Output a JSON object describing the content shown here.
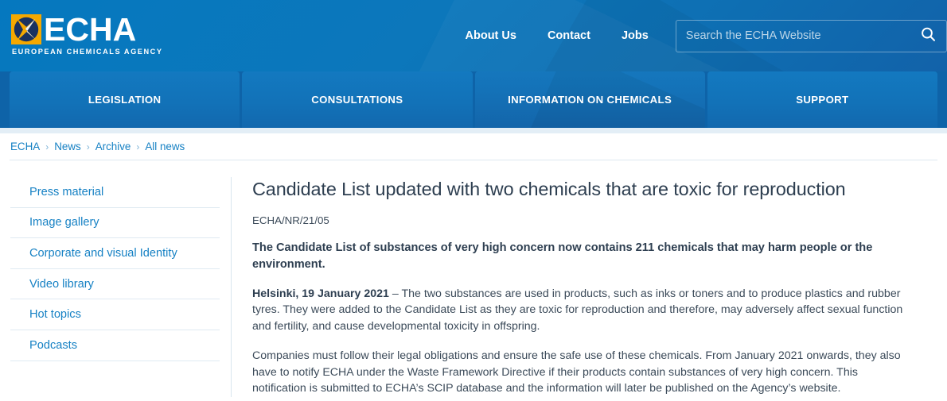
{
  "header": {
    "logo": {
      "mark_icon": "echa-star-logo-icon",
      "wordmark": "ECHA",
      "tagline": "EUROPEAN CHEMICALS AGENCY"
    },
    "top_links": [
      {
        "label": "About Us"
      },
      {
        "label": "Contact"
      },
      {
        "label": "Jobs"
      }
    ],
    "search": {
      "placeholder": "Search the ECHA Website",
      "value": "",
      "submit_icon": "search-icon"
    },
    "colors": {
      "header_bg": "#0c77bb",
      "nav_bg": "#0e63a8",
      "nav_tile": "#1272b8",
      "link_blue": "#1681c4",
      "logo_orange": "#f5a800",
      "logo_navy": "#1b3260"
    }
  },
  "main_nav": {
    "items": [
      {
        "label": "LEGISLATION",
        "active": false
      },
      {
        "label": "CONSULTATIONS",
        "active": false
      },
      {
        "label": "INFORMATION ON CHEMICALS",
        "active": true
      },
      {
        "label": "SUPPORT",
        "active": false
      }
    ]
  },
  "breadcrumb": {
    "separator": "›",
    "items": [
      {
        "label": "ECHA"
      },
      {
        "label": "News"
      },
      {
        "label": "Archive"
      },
      {
        "label": "All news"
      }
    ]
  },
  "sidebar": {
    "items": [
      {
        "label": "Press material"
      },
      {
        "label": "Image gallery"
      },
      {
        "label": "Corporate and visual Identity"
      },
      {
        "label": "Video library"
      },
      {
        "label": "Hot topics"
      },
      {
        "label": "Podcasts"
      }
    ]
  },
  "article": {
    "title": "Candidate List updated with two chemicals that are toxic for reproduction",
    "reference": "ECHA/NR/21/05",
    "lead": "The Candidate List of substances of very high concern now contains 211 chemicals that may harm people or the environment.",
    "dateline": "Helsinki, 19 January 2021",
    "dateline_dash": " – ",
    "paragraph_1_rest": "The two substances are used in products, such as inks or toners and to produce plastics and rubber tyres. They were added to the Candidate List as they are toxic for reproduction and therefore, may adversely affect sexual function and fertility, and cause developmental toxicity in offspring.",
    "paragraph_2": "Companies must follow their legal obligations and ensure the safe use of these chemicals. From January 2021 onwards, they also have to notify ECHA under the Waste Framework Directive if their products contain substances of very high concern. This notification is submitted to ECHA’s SCIP database and the information will later be published on the Agency’s website."
  }
}
